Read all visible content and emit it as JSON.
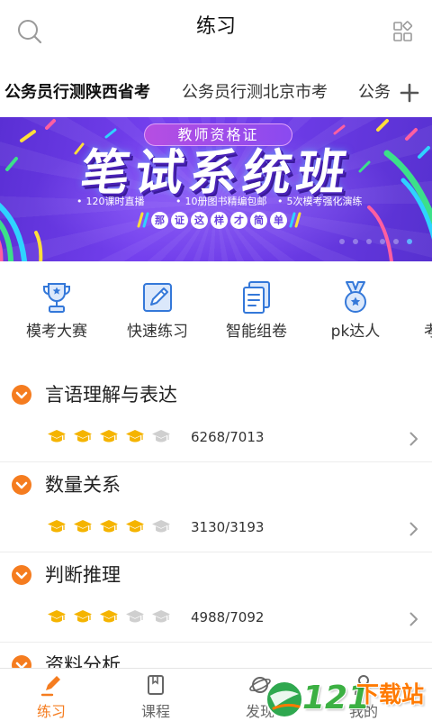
{
  "header": {
    "title": "练习",
    "search_icon": "search-icon",
    "menu_icon": "grid-icon"
  },
  "tabs": {
    "items": [
      {
        "label": "公务员行测陕西省考",
        "active": true
      },
      {
        "label": "公务员行测北京市考",
        "active": false
      },
      {
        "label": "公务",
        "active": false
      }
    ],
    "add_icon": "plus-icon"
  },
  "banner": {
    "badge": "教师资格证",
    "headline": "笔试系统班",
    "features": [
      "120课时直播",
      "10册图书精编包邮",
      "5次模考强化演练"
    ],
    "slogan": [
      "那",
      "证",
      "这",
      "样",
      "才",
      "简",
      "单"
    ],
    "slide_count": 6,
    "active_slide": 6
  },
  "shortcuts": [
    {
      "label": "模考大赛",
      "icon": "trophy-icon"
    },
    {
      "label": "快速练习",
      "icon": "edit-icon"
    },
    {
      "label": "智能组卷",
      "icon": "document-icon"
    },
    {
      "label": "pk达人",
      "icon": "medal-icon"
    },
    {
      "label": "考"
    }
  ],
  "categories": [
    {
      "title": "言语理解与表达",
      "level": 4,
      "max_level": 5,
      "progress": "6268/7013"
    },
    {
      "title": "数量关系",
      "level": 4,
      "max_level": 5,
      "progress": "3130/3193"
    },
    {
      "title": "判断推理",
      "level": 3,
      "max_level": 5,
      "progress": "4988/7092"
    },
    {
      "title": "资料分析"
    }
  ],
  "bottom_nav": {
    "items": [
      {
        "label": "练习",
        "icon": "pencil-icon"
      },
      {
        "label": "课程",
        "icon": "book-icon"
      },
      {
        "label": "发现",
        "icon": "planet-icon"
      },
      {
        "label": "我的",
        "icon": "person-icon"
      }
    ],
    "active_index": 0
  },
  "watermark": {
    "number": "121",
    "text": "下载站"
  },
  "colors": {
    "accent": "#f57c1f",
    "icon_blue": "#3478d9",
    "cap_filled": "#f5b400",
    "cap_empty": "#cfcfcf",
    "banner_purple": "#6c3be6"
  }
}
